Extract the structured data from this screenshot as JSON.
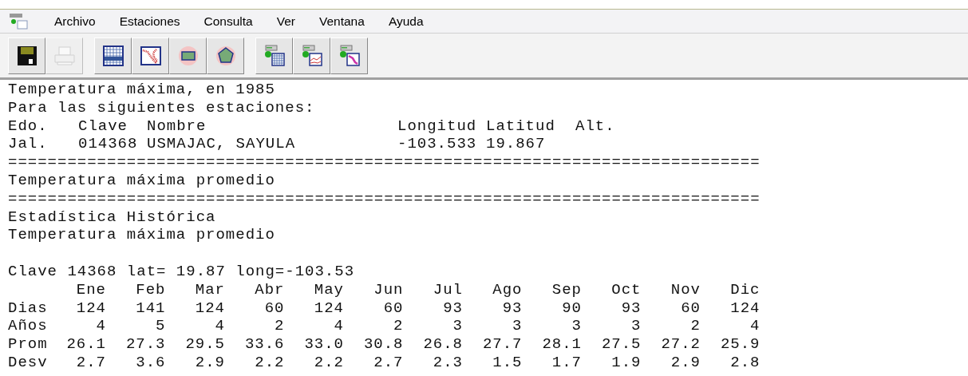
{
  "menu": [
    "Archivo",
    "Estaciones",
    "Consulta",
    "Ver",
    "Ventana",
    "Ayuda"
  ],
  "toolbar": [
    [
      {
        "kind": "save",
        "disabled": false
      },
      {
        "kind": "print",
        "disabled": true
      }
    ],
    [
      {
        "kind": "grid",
        "disabled": false
      },
      {
        "kind": "map",
        "disabled": false
      },
      {
        "kind": "rect",
        "disabled": false
      },
      {
        "kind": "pentagon",
        "disabled": false
      }
    ],
    [
      {
        "kind": "station-table",
        "disabled": false
      },
      {
        "kind": "station-chart",
        "disabled": false
      },
      {
        "kind": "station-map",
        "disabled": false
      }
    ]
  ],
  "report": {
    "title": "Temperatura máxima, en 1985",
    "subtitle": "Para las siguientes estaciones:",
    "stations": {
      "columns": [
        "Edo.",
        "Clave",
        "Nombre",
        "Longitud",
        "Latitud",
        "Alt."
      ],
      "rows": [
        [
          "Jal.",
          "014368",
          "USMAJAC, SAYULA",
          "-103.533",
          "19.867"
        ]
      ]
    },
    "separator_1": "============================================================================",
    "section": "Temperatura máxima promedio",
    "separator_2": "============================================================================",
    "history_title": "Estadística Histórica",
    "history_subtitle": "Temperatura máxima promedio",
    "station_line": "Clave 14368 lat= 19.87 long=-103.53",
    "stats": {
      "columns": [
        "Ene",
        "Feb",
        "Mar",
        "Abr",
        "May",
        "Jun",
        "Jul",
        "Ago",
        "Sep",
        "Oct",
        "Nov",
        "Dic"
      ],
      "rows": [
        {
          "label": "Dias",
          "values": [
            "124",
            "141",
            "124",
            "60",
            "124",
            "60",
            "93",
            "93",
            "90",
            "93",
            "60",
            "124"
          ]
        },
        {
          "label": "Años",
          "values": [
            "4",
            "5",
            "4",
            "2",
            "4",
            "2",
            "3",
            "3",
            "3",
            "3",
            "2",
            "4"
          ]
        },
        {
          "label": "Prom",
          "values": [
            "26.1",
            "27.3",
            "29.5",
            "33.6",
            "33.0",
            "30.8",
            "26.8",
            "27.7",
            "28.1",
            "27.5",
            "27.2",
            "25.9"
          ]
        },
        {
          "label": "Desv",
          "values": [
            "2.7",
            "3.6",
            "2.9",
            "2.2",
            "2.2",
            "2.7",
            "2.3",
            "1.5",
            "1.7",
            "1.9",
            "2.9",
            "2.8"
          ]
        }
      ]
    }
  }
}
